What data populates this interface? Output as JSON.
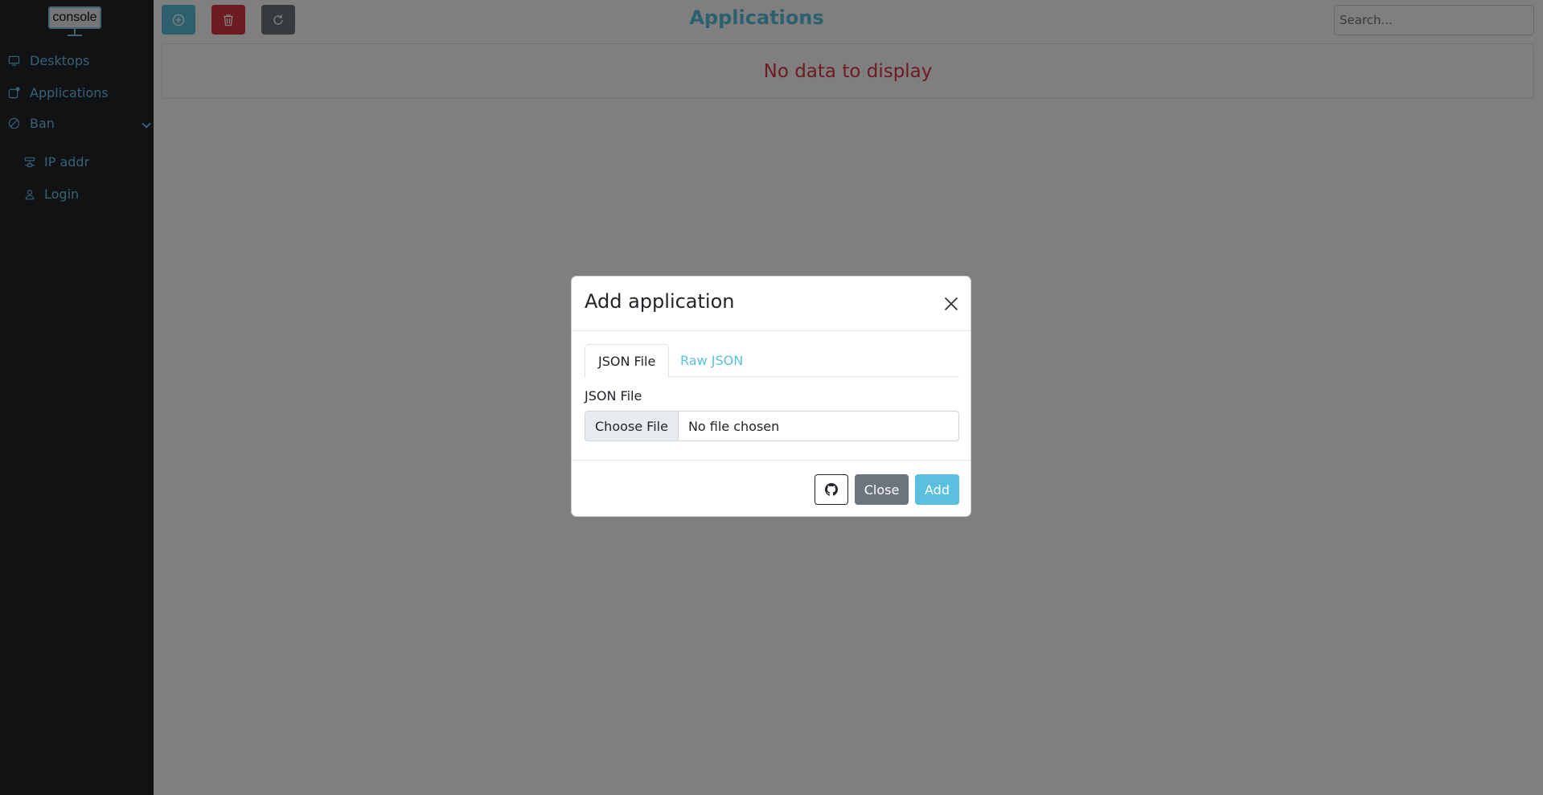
{
  "sidebar": {
    "logo_text": "console",
    "items": [
      {
        "label": "Desktops",
        "icon": "monitor-icon"
      },
      {
        "label": "Applications",
        "icon": "app-icon"
      },
      {
        "label": "Ban",
        "icon": "ban-icon"
      }
    ],
    "subitems": [
      {
        "label": "IP addr",
        "icon": "network-icon"
      },
      {
        "label": "Login",
        "icon": "user-icon"
      }
    ]
  },
  "toolbar": {
    "add_icon": "plus-circle-icon",
    "delete_icon": "trash-icon",
    "refresh_icon": "refresh-icon"
  },
  "page": {
    "title": "Applications",
    "search_placeholder": "Search...",
    "empty_message": "No data to display"
  },
  "modal": {
    "title": "Add application",
    "tabs": [
      {
        "label": "JSON File",
        "active": true
      },
      {
        "label": "Raw JSON",
        "active": false
      }
    ],
    "field_label": "JSON File",
    "file_button": "Choose File",
    "file_status": "No file chosen",
    "footer": {
      "github_icon": "github-icon",
      "close_label": "Close",
      "add_label": "Add"
    }
  },
  "colors": {
    "accent": "#5bc0de",
    "danger": "#dc3545",
    "secondary": "#6c757d",
    "sidebar_bg": "#212529"
  }
}
